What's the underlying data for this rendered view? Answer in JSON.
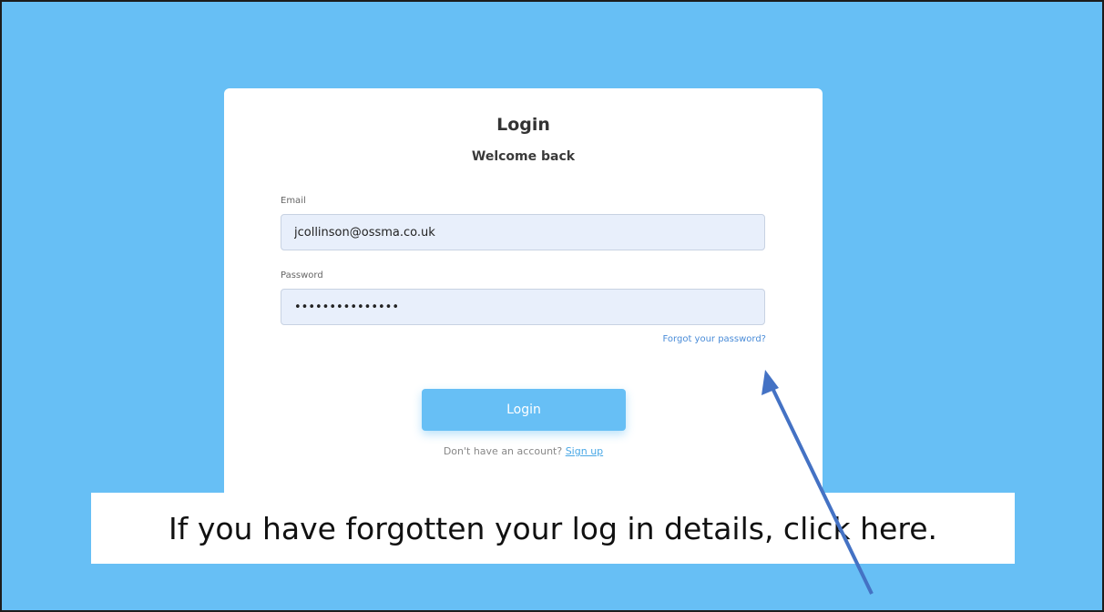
{
  "login_card": {
    "title": "Login",
    "subtitle": "Welcome back",
    "email_label": "Email",
    "email_value": "jcollinson@ossma.co.uk",
    "password_label": "Password",
    "password_masked": "•••••••••••••••",
    "forgot_link": "Forgot your password?",
    "login_button": "Login",
    "signup_prompt": "Don't have an account?",
    "signup_link": "Sign up"
  },
  "annotation": {
    "callout_text": "If you have forgotten your log in details, click here.",
    "arrow_icon": "arrow-pointer-icon"
  },
  "colors": {
    "background": "#67bff5",
    "arrow": "#4472c4",
    "link": "#4a8cd8",
    "field_bg": "#e8effb"
  }
}
